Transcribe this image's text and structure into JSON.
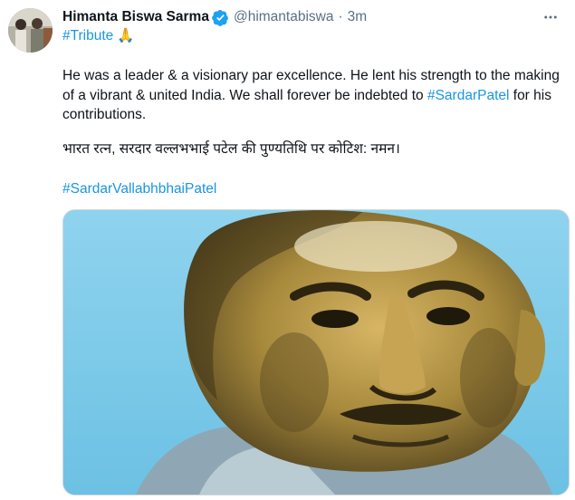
{
  "author": {
    "name": "Himanta Biswa Sarma",
    "handle": "@himantabiswa",
    "separator": "·",
    "time": "3m",
    "verified_icon": "verified-badge-icon"
  },
  "tagline": {
    "hashtag": "#Tribute",
    "emoji": "🙏"
  },
  "tweet": {
    "text_before": "He was a leader & a visionary par excellence. He lent his strength to the making of a vibrant & united India. We shall forever be indebted to ",
    "hashtag": "#SardarPatel",
    "text_after": " for his contributions.",
    "hindi": "भारत रत्न, सरदार वल्लभभाई पटेल की पुण्यतिथि पर कोटिश: नमन।",
    "hashtag2": "#SardarVallabhbhaiPatel"
  },
  "colors": {
    "link": "#1b95e0",
    "muted": "#5b7083",
    "text": "#0f1419",
    "media_bg": "#7ec9e8",
    "portrait": "#a88a3c"
  }
}
